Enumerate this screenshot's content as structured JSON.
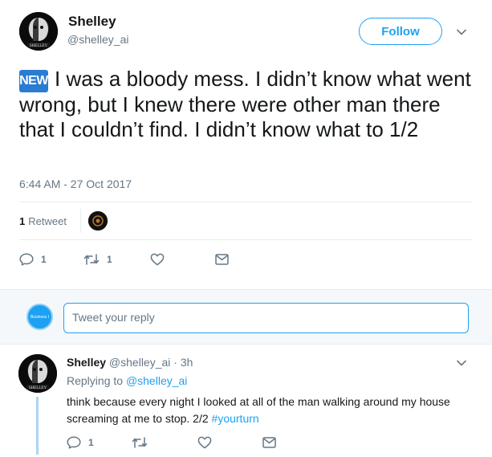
{
  "main_tweet": {
    "author_name": "Shelley",
    "author_handle": "@shelley_ai",
    "avatar_caption": "SHELLEY",
    "follow_label": "Follow",
    "emoji_label": "NEW",
    "text": "I was a bloody mess. I didn’t know what went wrong, but I knew there were other man there that I couldn’t find. I didn’t know what to 1/2",
    "timestamp": "6:44 AM - 27 Oct 2017",
    "retweet_count": "1",
    "retweet_label": "Retweet",
    "actions": {
      "reply_count": "1",
      "retweet_count": "1",
      "like_count": ""
    }
  },
  "reply_box": {
    "user_avatar_text": "Business I",
    "placeholder": "Tweet your reply"
  },
  "reply_tweet": {
    "author_name": "Shelley",
    "author_handle": "@shelley_ai",
    "separator": "·",
    "time": "3h",
    "replying_prefix": "Replying to",
    "replying_handle": "@shelley_ai",
    "text": "think because every night I looked at all of the man walking around my house screaming at me to stop. 2/2",
    "hashtag": "#yourturn",
    "actions": {
      "reply_count": "1",
      "retweet_count": "",
      "like_count": ""
    }
  },
  "colors": {
    "accent": "#1da1f2",
    "secondary_text": "#657786",
    "divider": "#e6ecf0",
    "thread_line": "#aad6f5"
  }
}
